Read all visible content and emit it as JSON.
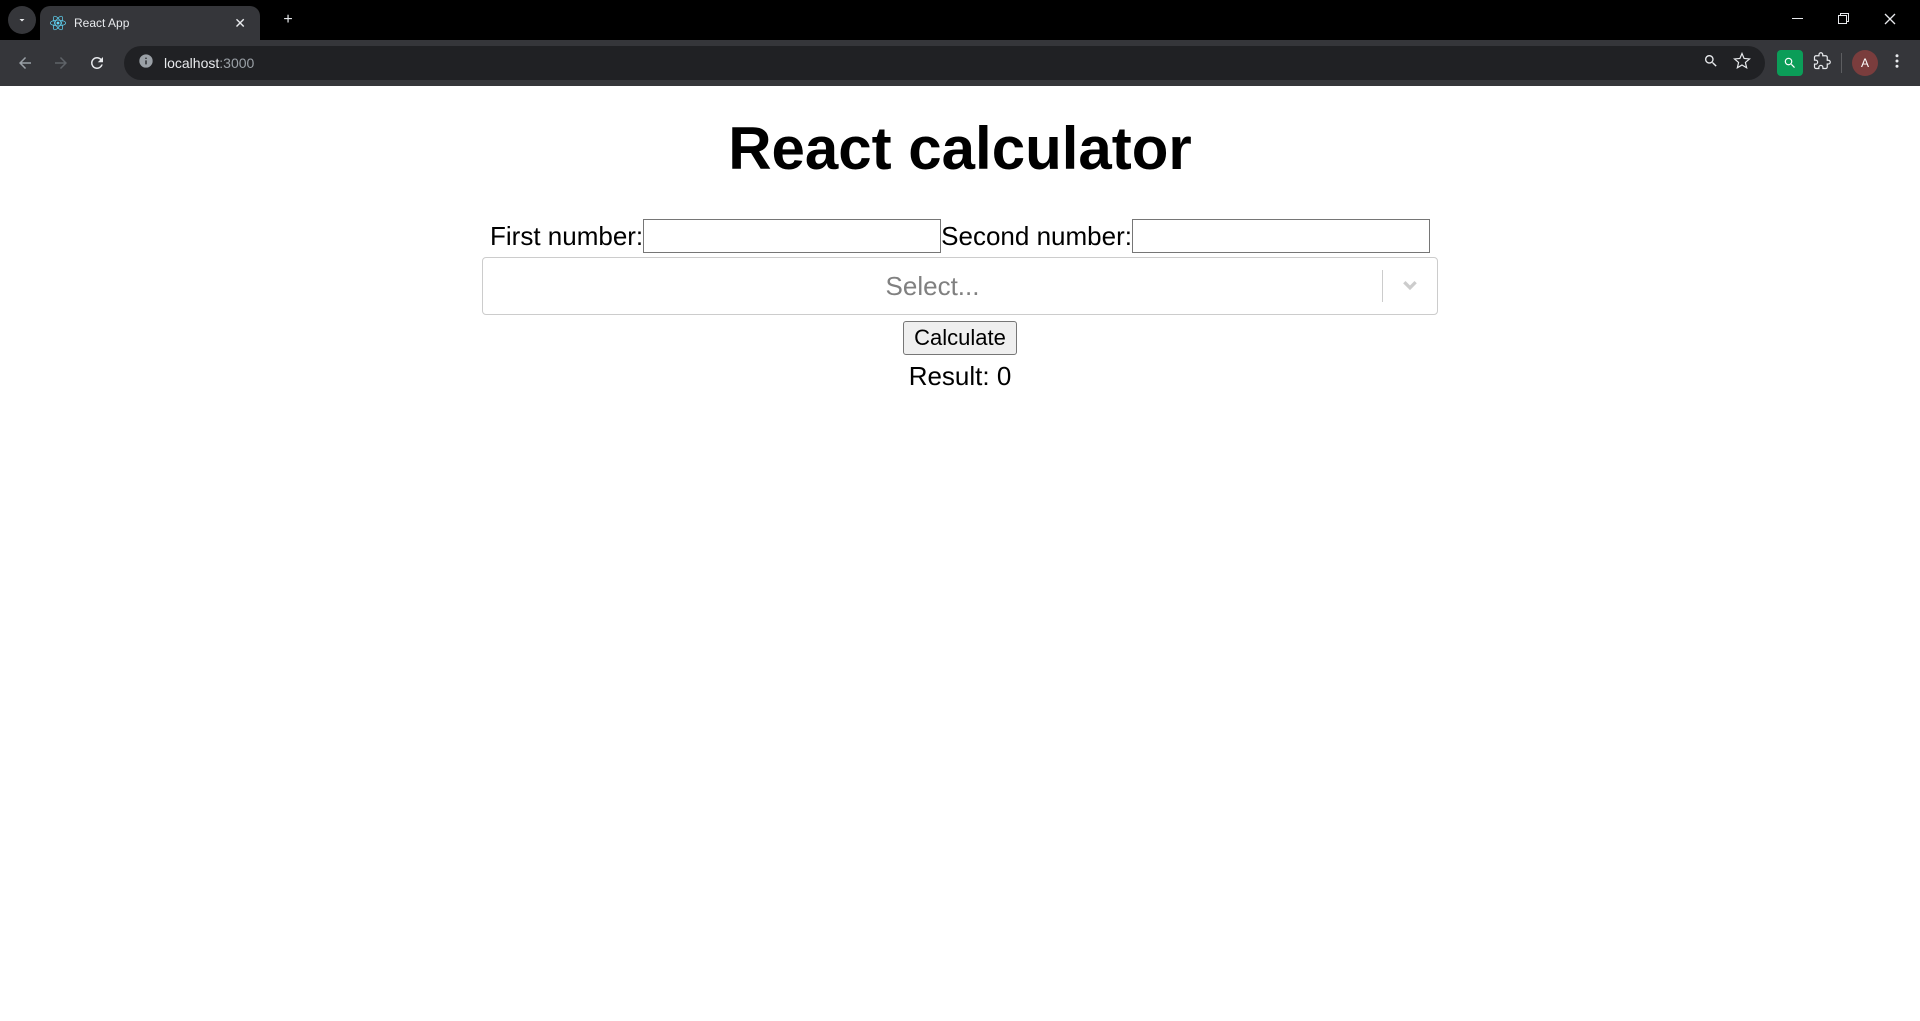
{
  "browser": {
    "tab_title": "React App",
    "url_host": "localhost",
    "url_path": ":3000",
    "avatar_initial": "A"
  },
  "app": {
    "title": "React calculator",
    "first_label": "First number:",
    "first_value": "",
    "second_label": "Second number:",
    "second_value": "",
    "select_placeholder": "Select...",
    "calc_button": "Calculate",
    "result_label": "Result: ",
    "result_value": "0"
  }
}
